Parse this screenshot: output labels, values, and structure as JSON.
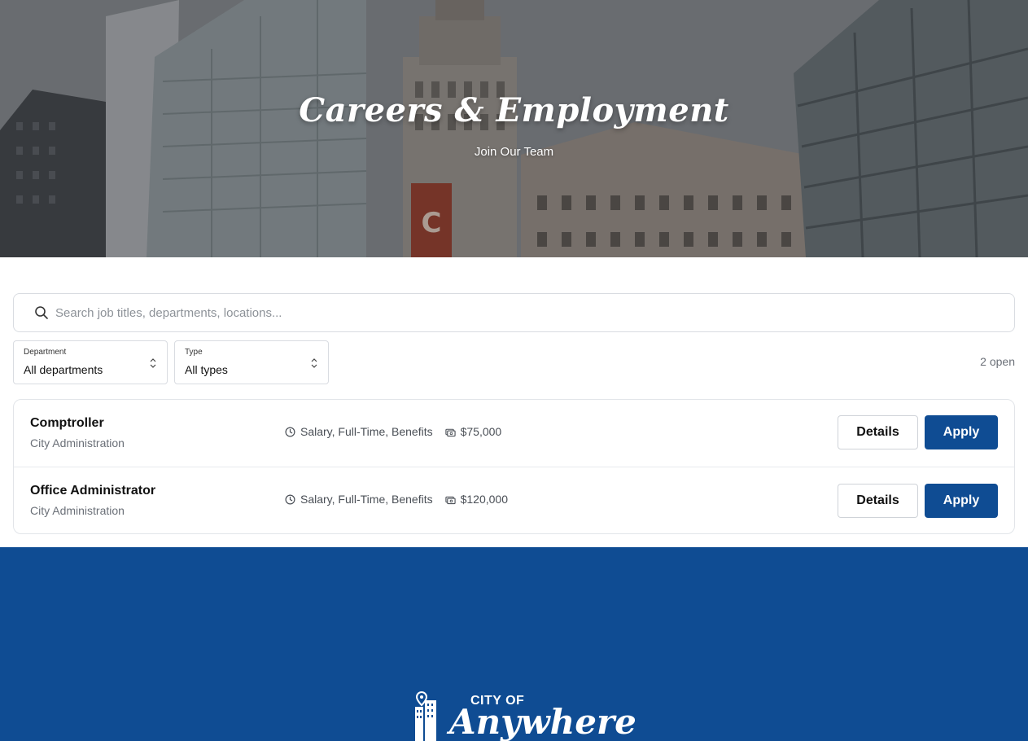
{
  "hero": {
    "title": "Careers & Employment",
    "subtitle": "Join Our Team"
  },
  "search": {
    "placeholder": "Search job titles, departments, locations...",
    "value": ""
  },
  "filters": {
    "department": {
      "label": "Department",
      "value": "All departments"
    },
    "type": {
      "label": "Type",
      "value": "All types"
    }
  },
  "open_count": "2 open",
  "jobs": [
    {
      "title": "Comptroller",
      "department": "City Administration",
      "terms": "Salary, Full-Time, Benefits",
      "salary": "$75,000",
      "details_label": "Details",
      "apply_label": "Apply"
    },
    {
      "title": "Office Administrator",
      "department": "City Administration",
      "terms": "Salary, Full-Time, Benefits",
      "salary": "$120,000",
      "details_label": "Details",
      "apply_label": "Apply"
    }
  ],
  "footer": {
    "logo_small": "CITY OF",
    "logo_big": "Anywhere"
  },
  "colors": {
    "brand_blue": "#0f4c93",
    "muted_text": "#6b7078"
  },
  "icons": {
    "search": "search-icon",
    "clock": "clock-icon",
    "money": "money-icon",
    "chevron": "chevron-updown-icon",
    "logo": "city-map-pin-logo"
  }
}
